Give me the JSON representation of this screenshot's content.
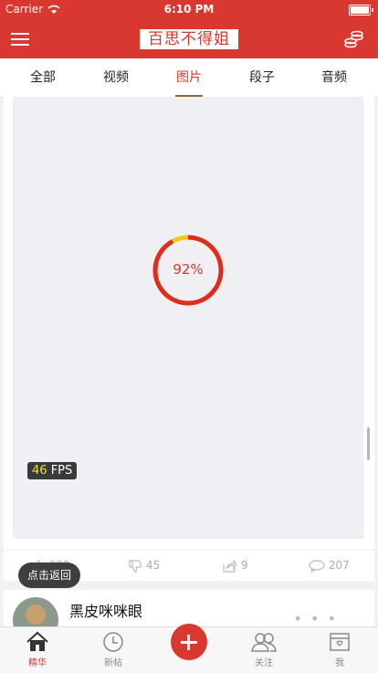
{
  "status": {
    "carrier": "Carrier",
    "time": "6:10 PM"
  },
  "header": {
    "logo": "百思不得姐"
  },
  "tabs": [
    {
      "label": "全部"
    },
    {
      "label": "视频"
    },
    {
      "label": "图片"
    },
    {
      "label": "段子"
    },
    {
      "label": "音频"
    }
  ],
  "post": {
    "progress_label": "92%",
    "progress": 0.92,
    "fps_value": "46",
    "fps_unit": "FPS",
    "actions": {
      "like": "222",
      "dislike": "45",
      "share": "9",
      "comment": "207"
    }
  },
  "toast": "点击返回",
  "next_post": {
    "author": "黑皮咪咪眼",
    "more": "• • •"
  },
  "tabbar": {
    "items": [
      {
        "label": "精华"
      },
      {
        "label": "新帖"
      },
      {
        "label": "关注"
      },
      {
        "label": "我"
      }
    ]
  },
  "colors": {
    "brand": "#d8382f",
    "progress_track": "#f5c518"
  }
}
